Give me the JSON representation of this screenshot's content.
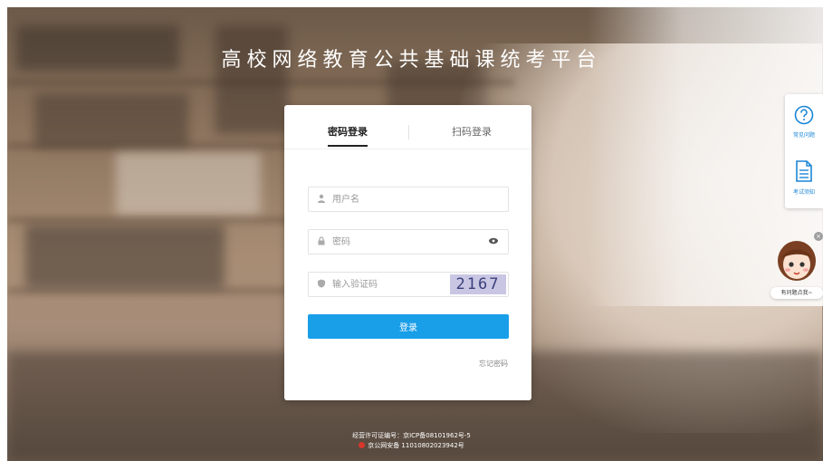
{
  "page": {
    "title": "高校网络教育公共基础课统考平台"
  },
  "login": {
    "tabs": [
      {
        "label": "密码登录",
        "active": true
      },
      {
        "label": "扫码登录",
        "active": false
      }
    ],
    "username": {
      "placeholder": "用户名",
      "icon": "user-icon"
    },
    "password": {
      "placeholder": "密码",
      "icon": "lock-icon",
      "toggle_icon": "eye-icon"
    },
    "captcha_field": {
      "placeholder": "输入验证码",
      "icon": "shield-icon",
      "captcha_text": "2167"
    },
    "submit_label": "登录",
    "forgot_label": "忘记密码",
    "accent_color": "#199ee8"
  },
  "sidebar": {
    "items": [
      {
        "label": "常见问题",
        "icon": "question-circle-icon"
      },
      {
        "label": "考试须知",
        "icon": "document-icon"
      }
    ],
    "assistant": {
      "label": "有问题点我~",
      "icon": "assistant-avatar-icon",
      "close_icon": "close-icon"
    }
  },
  "footer": {
    "license": "经营许可证编号：京ICP备08101962号-5",
    "security": "京公网安备 11010802023942号"
  }
}
